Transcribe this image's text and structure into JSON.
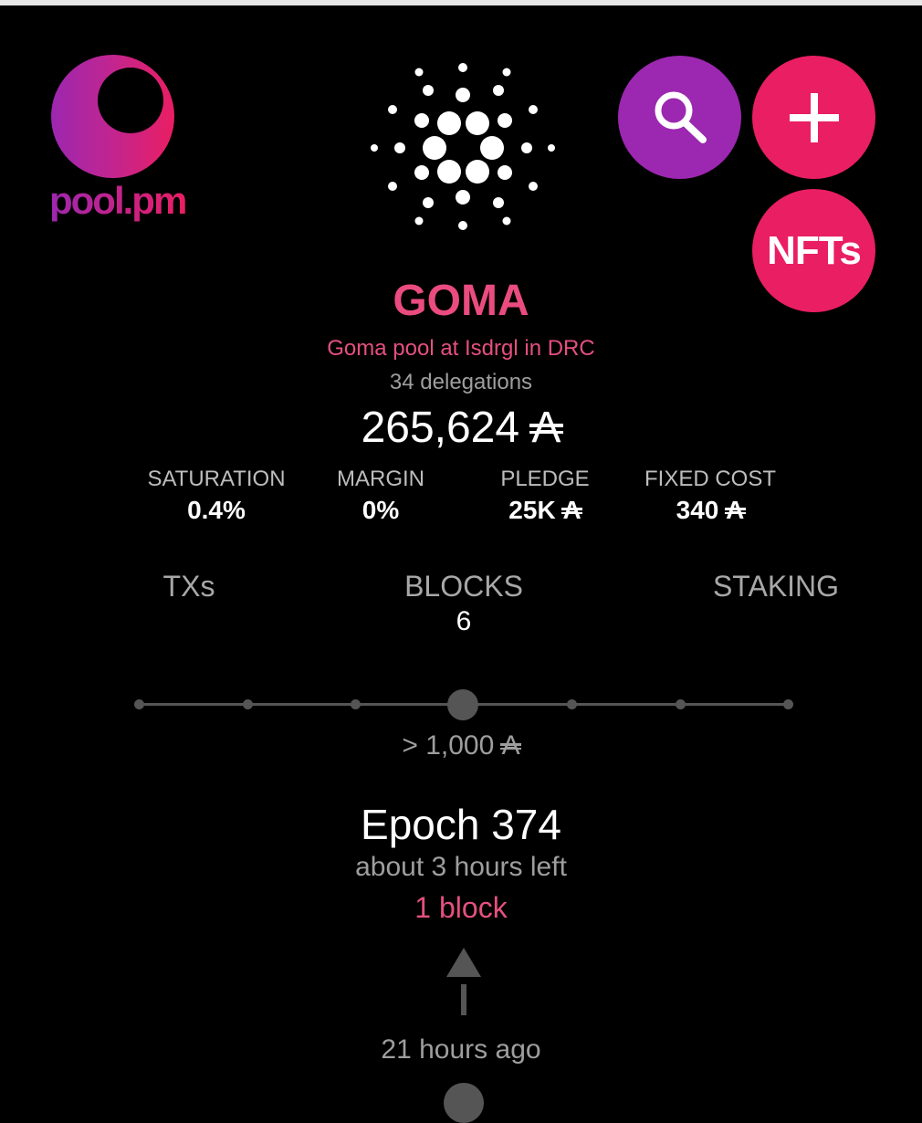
{
  "brand": {
    "logo_text": "pool.pm"
  },
  "header": {
    "cardano_icon": "cardano-logo-icon",
    "search_icon": "search-icon",
    "add_icon": "plus-icon",
    "nfts_label": "NFTs"
  },
  "pool": {
    "ticker": "GOMA",
    "description": "Goma pool at Isdrgl in DRC",
    "delegations": "34 delegations",
    "live_stake": "265,624",
    "ada_symbol": "A"
  },
  "stats": [
    {
      "label": "SATURATION",
      "value": "0.4%"
    },
    {
      "label": "MARGIN",
      "value": "0%"
    },
    {
      "label": "PLEDGE",
      "value": "25K"
    },
    {
      "label": "FIXED COST",
      "value": "340"
    }
  ],
  "tabs": [
    {
      "label": "TXs"
    },
    {
      "label": "BLOCKS",
      "count": "6"
    },
    {
      "label": "STAKING"
    }
  ],
  "filter": {
    "value": "> 1,000",
    "selected_step": 4,
    "total_steps": 7
  },
  "epoch": {
    "title": "Epoch 374",
    "time_left": "about 3 hours left",
    "blocks": "1 block"
  },
  "timeline": {
    "last_block": "21 hours ago"
  },
  "colors": {
    "accent_pink": "#e91e63",
    "accent_purple": "#9c27b0",
    "name_pink": "#ea4c7f"
  }
}
